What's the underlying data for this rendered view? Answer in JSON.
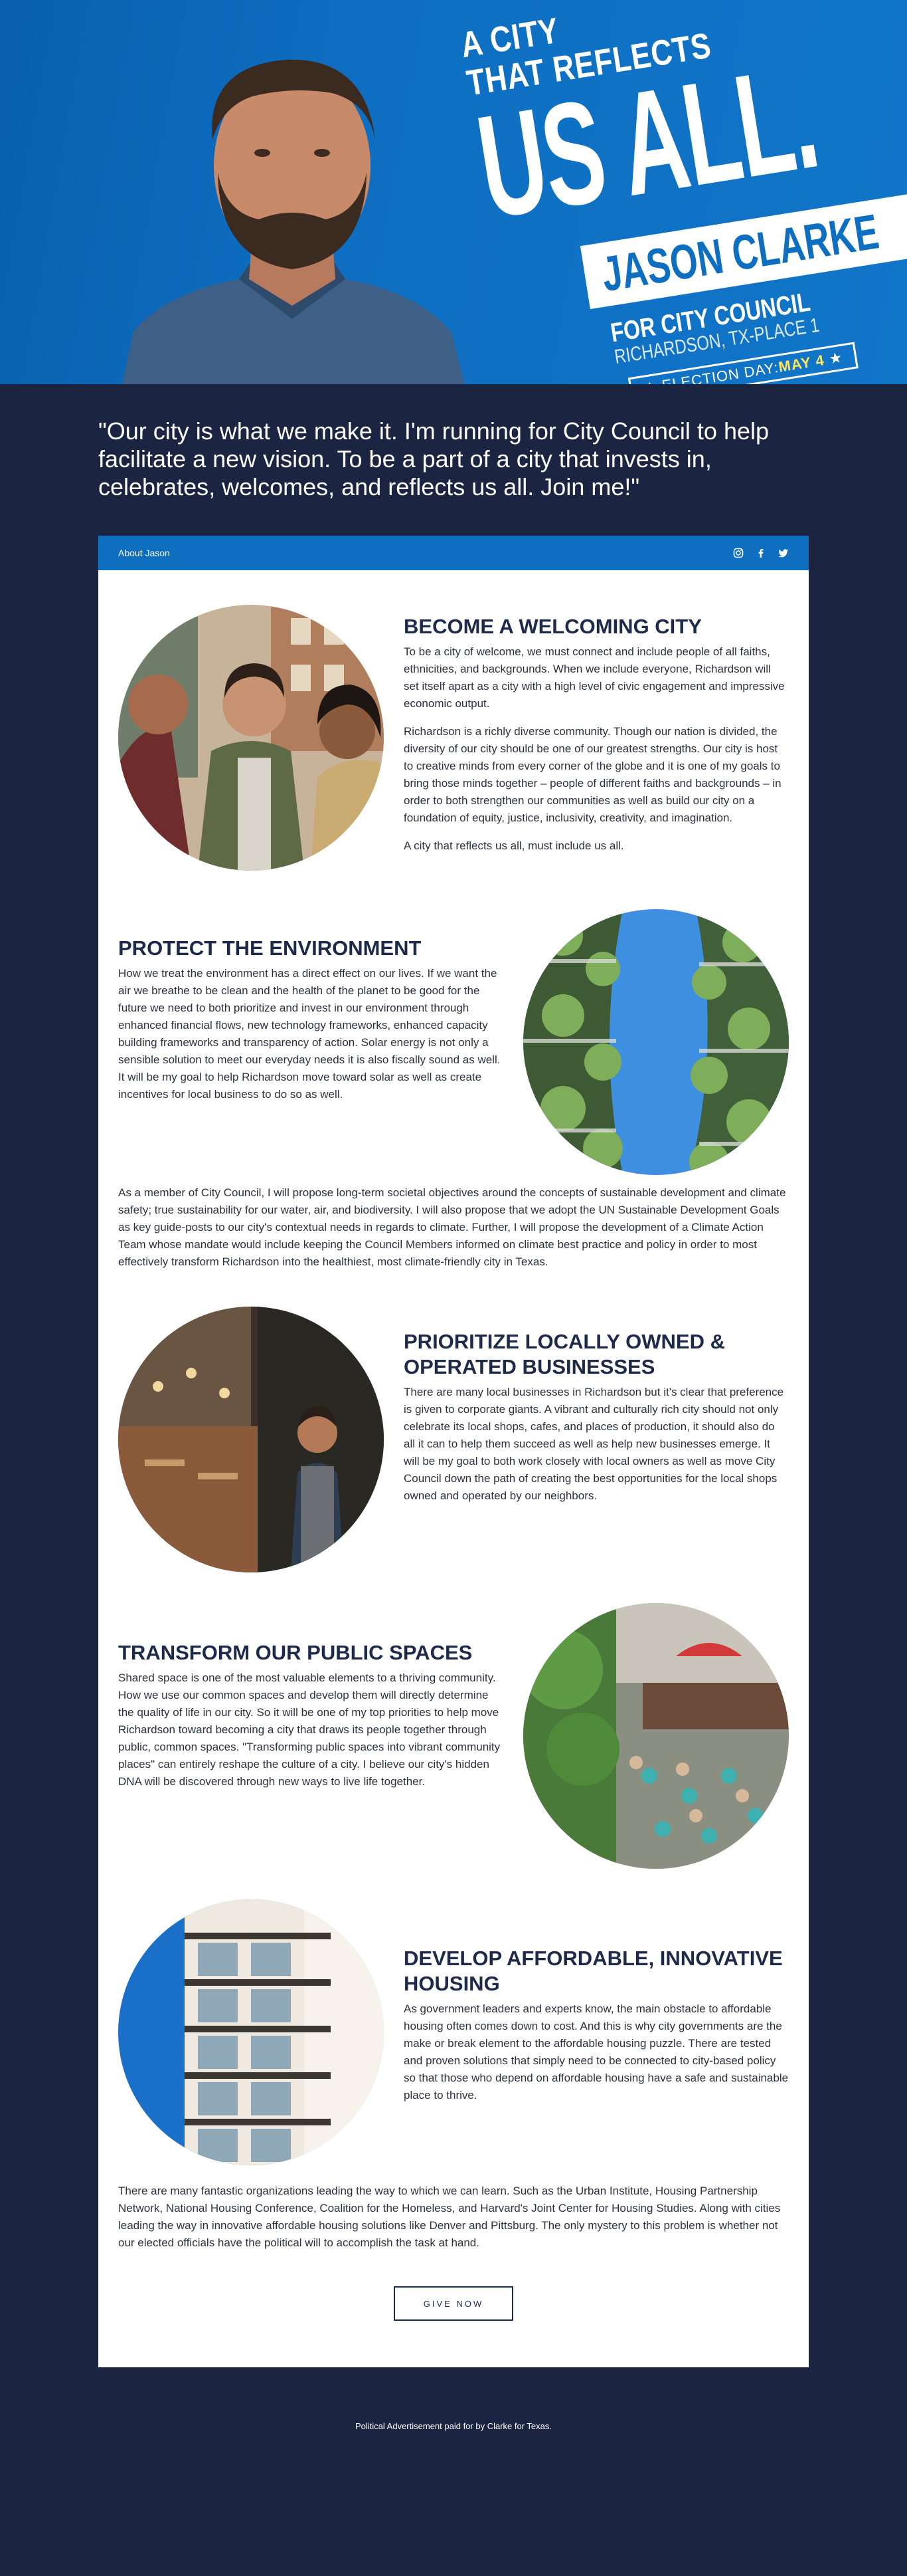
{
  "hero": {
    "tagline_small_1": "A CITY",
    "tagline_small_2": "THAT REFLECTS",
    "tagline_big": "US ALL.",
    "candidate_name": "JASON CLARKE",
    "office": "FOR CITY COUNCIL",
    "district": "RICHARDSON, TX-PLACE 1",
    "election_label": "ELECTION DAY:",
    "election_date": "MAY 4"
  },
  "quote": "\"Our city is what we make it. I'm running for City Council to help facilitate a new vision. To be a part of a city that invests in, celebrates, welcomes, and reflects us all. Join me!\"",
  "card": {
    "about_link": "About Jason",
    "socials": [
      "instagram-icon",
      "facebook-icon",
      "twitter-icon"
    ]
  },
  "sections": [
    {
      "title": "BECOME A WELCOMING CITY",
      "paragraphs": [
        "To be a city of welcome, we must connect and include people of all faiths, ethnicities, and backgrounds. When we include everyone, Richardson will set itself apart as a city with a high level of civic engagement and impressive economic output.",
        "Richardson is a richly diverse community. Though our nation is divided, the diversity of our city should be one of our greatest strengths. Our city is host to creative minds from every corner of the globe and it is one of my goals to bring those minds together – people of different faiths and backgrounds – in order to both strengthen our communities as well as build our city on a foundation of equity, justice, inclusivity, creativity, and imagination.",
        "A city that reflects us all, must include us all."
      ]
    },
    {
      "title": "PROTECT THE ENVIRONMENT",
      "paragraphs": [
        "How we treat the environment has a direct effect on our lives. If we want the air we breathe to be clean and the health of the planet to be good for the future we need to both prioritize and invest in our environment through enhanced financial flows, new technology frameworks, enhanced capacity building frameworks and transparency of action. Solar energy is not only a sensible solution to meet our everyday needs it is also fiscally sound as well. It will be my goal to help Richardson move toward solar as well as create incentives for local business to do so as well."
      ],
      "full": "As a member of City Council, I will propose long-term societal objectives around the concepts of sustainable development and climate safety; true sustainability for our water, air, and biodiversity. I will also propose that we adopt the UN Sustainable Development Goals as key guide-posts to our city's contextual needs in regards to climate. Further, I will propose the development of a Climate Action Team whose mandate would include keeping the Council Members informed on climate best practice and policy in order to most effectively transform Richardson into the healthiest, most climate-friendly city in Texas."
    },
    {
      "title": "PRIORITIZE LOCALLY OWNED & OPERATED BUSINESSES",
      "paragraphs": [
        "There are many local businesses in Richardson but it's clear that preference is given to corporate giants. A vibrant and culturally rich city should not only celebrate its local shops, cafes, and places of production, it should also do all it can to help them succeed as well as help new businesses emerge. It will be my goal to both work closely with local owners as well as move City Council down the path of creating the best opportunities for the local shops owned and operated by our neighbors."
      ]
    },
    {
      "title": "TRANSFORM OUR PUBLIC SPACES",
      "paragraphs": [
        "Shared space is one of the most valuable elements to a thriving community. How we use our common spaces and develop them will directly determine the quality of life in our city. So it will be one of my top priorities to help move Richardson toward becoming a city that draws its people together through public, common spaces. \"Transforming public spaces into vibrant community places\" can entirely reshape the culture of a city. I believe our city's hidden DNA will be discovered through new ways to live life together."
      ]
    },
    {
      "title": "DEVELOP AFFORDABLE, INNOVATIVE HOUSING",
      "paragraphs": [
        "As government leaders and experts know, the main obstacle to affordable housing often comes down to cost. And this is why city governments are the make or break element to the affordable housing puzzle. There are tested and proven solutions that simply need to be connected to city-based policy so that those who depend on affordable housing have a safe and sustainable place to thrive."
      ],
      "full": "There are many fantastic organizations leading the way to which we can learn. Such as the Urban Institute, Housing Partnership Network, National Housing Conference, Coalition for the Homeless, and Harvard's Joint Center for Housing Studies. Along with cities leading the way in innovative affordable housing solutions like Denver and Pittsburg. The only mystery to this problem is whether not our elected officials have the political will to accomplish the task at hand."
    }
  ],
  "cta": {
    "label": "GIVE NOW"
  },
  "footer": {
    "disclaimer": "Political Advertisement paid for by Clarke for Texas."
  },
  "colors": {
    "brand_blue": "#0e6ec0",
    "navy": "#1b2440",
    "heading": "#1e2a4a"
  }
}
